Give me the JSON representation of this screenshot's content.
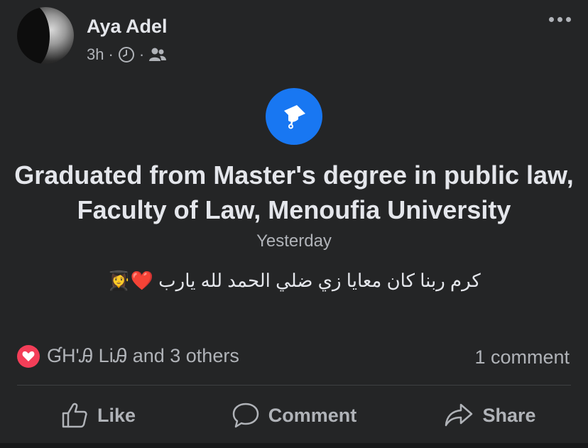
{
  "post": {
    "author": "Aya Adel",
    "time": "3h",
    "separator": "·",
    "milestone": {
      "title": "Graduated from Master's degree in public law, Faculty of Law, Menoufia University",
      "date": "Yesterday"
    },
    "caption": "كرم ربنا كان معايا زي ضلي الحمد لله يارب ❤️👩‍🎓",
    "reactions": {
      "summary": "ƓH'Ꭿ LiᎯ and 3 others",
      "type": "love-icon"
    },
    "comments": "1 comment"
  },
  "actions": {
    "like": "Like",
    "comment": "Comment",
    "share": "Share"
  },
  "colors": {
    "background": "#242526",
    "accent": "#1877f2",
    "love": "#f33e58",
    "text_primary": "#e4e6eb",
    "text_secondary": "#b0b3b8"
  }
}
